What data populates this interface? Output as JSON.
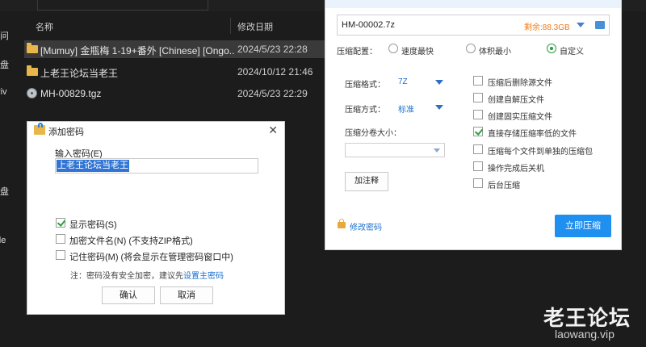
{
  "explorer": {
    "nav_items": [
      "访问",
      "云盘",
      "Driv",
      "云盘",
      " ",
      "ode"
    ],
    "columns": {
      "name": "名称",
      "date": "修改日期"
    },
    "files": [
      {
        "name": "[Mumuy] 金瓶梅 1-19+番外 [Chinese] [Ongo...",
        "date": "2024/5/23 22:28",
        "icon": "folder-icon",
        "selected": true
      },
      {
        "name": "上老王论坛当老王",
        "date": "2024/10/12 21:46",
        "icon": "folder-icon",
        "selected": false
      },
      {
        "name": "MH-00829.tgz",
        "date": "2024/5/23 22:29",
        "icon": "archive-file-icon",
        "selected": false
      }
    ]
  },
  "password_dialog": {
    "title": "添加密码",
    "input_label": "输入密码(E)",
    "input_value": "上老王论坛当老王",
    "options": [
      {
        "label": "显示密码(S)",
        "checked": true
      },
      {
        "label": "加密文件名(N) (不支持ZIP格式)",
        "checked": false
      },
      {
        "label": "记住密码(M) (将会显示在管理密码窗口中)",
        "checked": false
      }
    ],
    "note_text": "注：密码没有安全加密，建议先",
    "note_link": "设置主密码",
    "ok_label": "确认",
    "cancel_label": "取消"
  },
  "compress_panel": {
    "filename": "HM-00002.7z",
    "free_space": "剩余:88.3GB",
    "config_label": "压缩配置：",
    "presets": [
      {
        "label": "速度最快",
        "checked": false
      },
      {
        "label": "体积最小",
        "checked": false
      },
      {
        "label": "自定义",
        "checked": true
      }
    ],
    "format_label": "压缩格式：",
    "format_value": "7Z",
    "method_label": "压缩方式：",
    "method_value": "标准",
    "split_label": "压缩分卷大小：",
    "comment_button": "加注释",
    "options": [
      {
        "label": "压缩后删除源文件",
        "checked": false
      },
      {
        "label": "创建自解压文件",
        "checked": false
      },
      {
        "label": "创建固实压缩文件",
        "checked": false
      },
      {
        "label": "直接存储压缩率低的文件",
        "checked": true
      },
      {
        "label": "压缩每个文件到单独的压缩包",
        "checked": false
      },
      {
        "label": "操作完成后关机",
        "checked": false
      },
      {
        "label": "后台压缩",
        "checked": false
      }
    ],
    "modify_password": "修改密码",
    "compress_now": "立即压缩",
    "colors": {
      "accent": "#1f8ff0",
      "free_space": "#f07a1a",
      "check": "#2c9e3a"
    }
  },
  "watermark": {
    "title": "老王论坛",
    "url": "laowang.vip"
  }
}
